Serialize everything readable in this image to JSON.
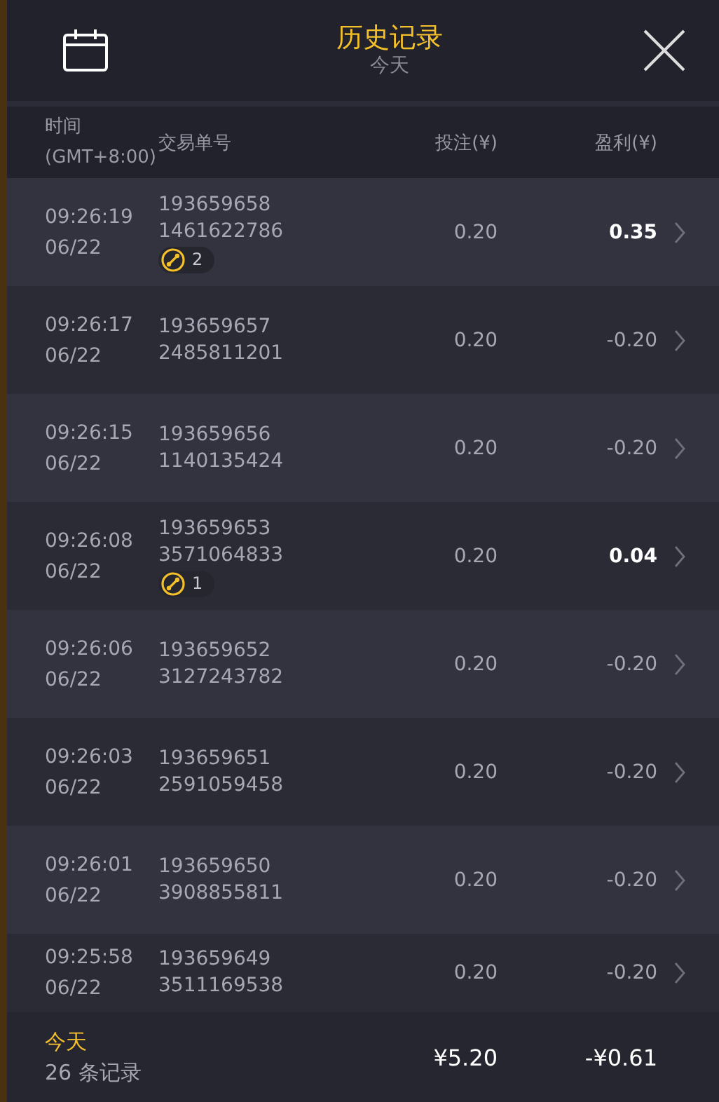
{
  "header": {
    "title": "历史记录",
    "subtitle": "今天"
  },
  "columns": {
    "time": "时间",
    "timezone": "(GMT+8:00)",
    "order": "交易单号",
    "bet": "投注(¥)",
    "profit": "盈利(¥)"
  },
  "rows": [
    {
      "time": "09:26:19",
      "date": "06/22",
      "ids": [
        "193659658",
        "1461622786"
      ],
      "badge": "2",
      "bet": "0.20",
      "profit": "0.35",
      "win": true
    },
    {
      "time": "09:26:17",
      "date": "06/22",
      "ids": [
        "193659657",
        "2485811201"
      ],
      "bet": "0.20",
      "profit": "-0.20",
      "win": false
    },
    {
      "time": "09:26:15",
      "date": "06/22",
      "ids": [
        "193659656",
        "1140135424"
      ],
      "bet": "0.20",
      "profit": "-0.20",
      "win": false
    },
    {
      "time": "09:26:08",
      "date": "06/22",
      "ids": [
        "193659653",
        "3571064833"
      ],
      "badge": "1",
      "bet": "0.20",
      "profit": "0.04",
      "win": true
    },
    {
      "time": "09:26:06",
      "date": "06/22",
      "ids": [
        "193659652",
        "3127243782"
      ],
      "bet": "0.20",
      "profit": "-0.20",
      "win": false
    },
    {
      "time": "09:26:03",
      "date": "06/22",
      "ids": [
        "193659651",
        "2591059458"
      ],
      "bet": "0.20",
      "profit": "-0.20",
      "win": false
    },
    {
      "time": "09:26:01",
      "date": "06/22",
      "ids": [
        "193659650",
        "3908855811"
      ],
      "bet": "0.20",
      "profit": "-0.20",
      "win": false
    },
    {
      "time": "09:25:58",
      "date": "06/22",
      "ids": [
        "193659649",
        "3511169538"
      ],
      "bet": "0.20",
      "profit": "-0.20",
      "win": false
    }
  ],
  "footer": {
    "period": "今天",
    "count": "26 条记录",
    "total_bet": "¥5.20",
    "total_profit": "-¥0.61"
  }
}
